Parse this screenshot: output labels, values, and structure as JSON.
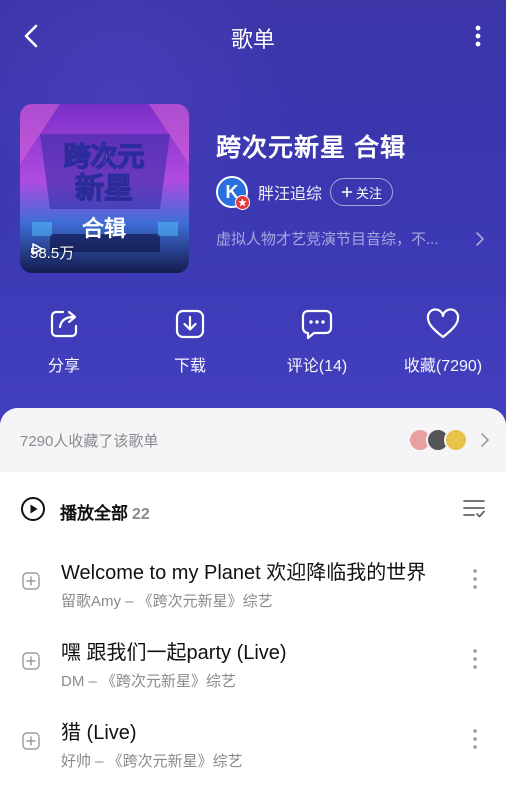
{
  "header": {
    "title": "歌单"
  },
  "playlist": {
    "cover_text_main": "跨次元新星",
    "cover_text_sub": "合辑",
    "play_count": "58.5万",
    "name": "跨次元新星 合辑",
    "creator": {
      "avatar_letter": "K",
      "name": "胖汪追综",
      "follow_label": "关注"
    },
    "description": "虚拟人物才艺竞演节目音综，不..."
  },
  "actions": [
    {
      "icon": "share-icon",
      "label": "分享"
    },
    {
      "icon": "download-icon",
      "label": "下载"
    },
    {
      "icon": "comment-icon",
      "label": "评论(14)"
    },
    {
      "icon": "heart-icon",
      "label": "收藏(7290)"
    }
  ],
  "favorites": {
    "text": "7290人收藏了该歌单",
    "avatar_colors": [
      "#e8a0a0",
      "#555555",
      "#e6c34a"
    ]
  },
  "playall": {
    "label": "播放全部",
    "count": "22"
  },
  "songs": [
    {
      "name": "Welcome to my Planet 欢迎降临我的世界",
      "meta": "留歌Amy – 《跨次元新星》综艺"
    },
    {
      "name": "嘿 跟我们一起party (Live)",
      "meta": "DM – 《跨次元新星》综艺"
    },
    {
      "name": "猎 (Live)",
      "meta": "好帅 – 《跨次元新星》综艺"
    }
  ],
  "colors": {
    "hero_bg": "#3b35a8",
    "accent_red": "#e53935",
    "text_gray": "#8a8a8f"
  }
}
